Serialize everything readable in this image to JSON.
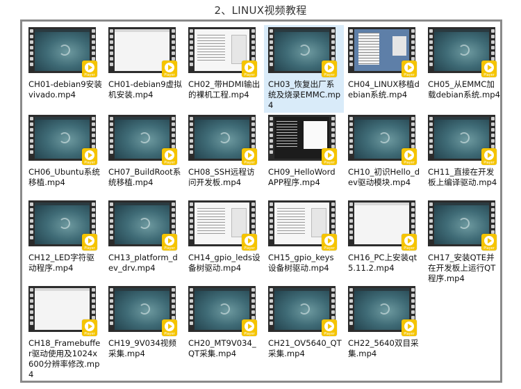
{
  "page_title": "2、LINUX视频教程",
  "badge_text": "Player",
  "files": [
    {
      "name": "CH01-debian9安装vivado.mp4",
      "thumb": "desktop"
    },
    {
      "name": "CH01-debian9虚拟机安装.mp4",
      "thumb": "white"
    },
    {
      "name": "CH02_带HDMI输出的裸机工程.mp4",
      "thumb": "doc"
    },
    {
      "name": "CH03_恢复出厂系统及烧录EMMC.mp4",
      "thumb": "desktop",
      "selected": true
    },
    {
      "name": "CH04_LINUX移植debian系统.mp4",
      "thumb": "mixed"
    },
    {
      "name": "CH05_从EMMC加载debian系统.mp4",
      "thumb": "desktop"
    },
    {
      "name": "CH06_Ubuntu系统移植.mp4",
      "thumb": "desktop"
    },
    {
      "name": "CH07_BuildRoot系统移植.mp4",
      "thumb": "desktop"
    },
    {
      "name": "CH08_SSH远程访问开发板.mp4",
      "thumb": "desktop"
    },
    {
      "name": "CH09_HelloWord APP程序.mp4",
      "thumb": "term"
    },
    {
      "name": "CH10_初识Hello_dev驱动模块.mp4",
      "thumb": "desktop"
    },
    {
      "name": "CH11_直接在开发板上编译驱动.mp4",
      "thumb": "desktop"
    },
    {
      "name": "CH12_LED字符驱动程序.mp4",
      "thumb": "desktop"
    },
    {
      "name": "CH13_platform_dev_drv.mp4",
      "thumb": "desktop"
    },
    {
      "name": "CH14_gpio_leds设备树驱动.mp4",
      "thumb": "doc"
    },
    {
      "name": "CH15_gpio_keys设备树驱动.mp4",
      "thumb": "doc"
    },
    {
      "name": "CH16_PC上安装qt5.11.2.mp4",
      "thumb": "white"
    },
    {
      "name": "CH17_安装QTE并在开发板上运行QT程序.mp4",
      "thumb": "desktop"
    },
    {
      "name": "CH18_Framebuffer驱动使用及1024x600分辨率修改.mp4",
      "thumb": "white"
    },
    {
      "name": "CH19_9V034视频采集.mp4",
      "thumb": "desktop"
    },
    {
      "name": "CH20_MT9V034_QT采集.mp4",
      "thumb": "desktop"
    },
    {
      "name": "CH21_OV5640_QT采集.mp4",
      "thumb": "desktop"
    },
    {
      "name": "CH22_5640双目采集.mp4",
      "thumb": "desktop"
    }
  ]
}
